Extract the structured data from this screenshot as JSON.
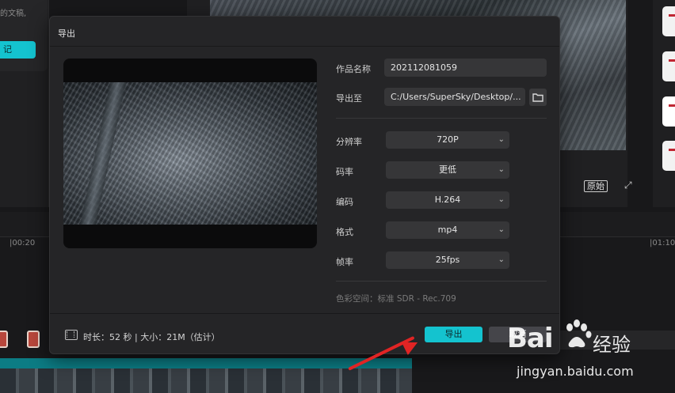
{
  "background": {
    "left_panel_text": "的文稿,",
    "left_panel_button": "记",
    "original_button": "原始",
    "timeline_ticks": [
      "|00:20",
      "|01:10"
    ]
  },
  "dialog": {
    "title": "导出",
    "name_label": "作品名称",
    "name_value": "202112081059",
    "export_to_label": "导出至",
    "export_path": "C:/Users/SuperSky/Desktop/...",
    "settings": [
      {
        "label": "分辨率",
        "value": "720P"
      },
      {
        "label": "码率",
        "value": "更低"
      },
      {
        "label": "编码",
        "value": "H.264"
      },
      {
        "label": "格式",
        "value": "mp4"
      },
      {
        "label": "帧率",
        "value": "25fps"
      }
    ],
    "color_space": "色彩空间：标准 SDR - Rec.709",
    "footer_info": "时长：52 秒 | 大小：21M（估计）",
    "export_button": "导出",
    "cancel_button": "取消"
  },
  "watermark": {
    "brand_latin": "Bai",
    "brand_cn": "经验",
    "url": "jingyan.baidu.com"
  },
  "colors": {
    "accent": "#14c3cf",
    "dialog_bg": "#252527",
    "annotation_arrow": "#e12424"
  }
}
